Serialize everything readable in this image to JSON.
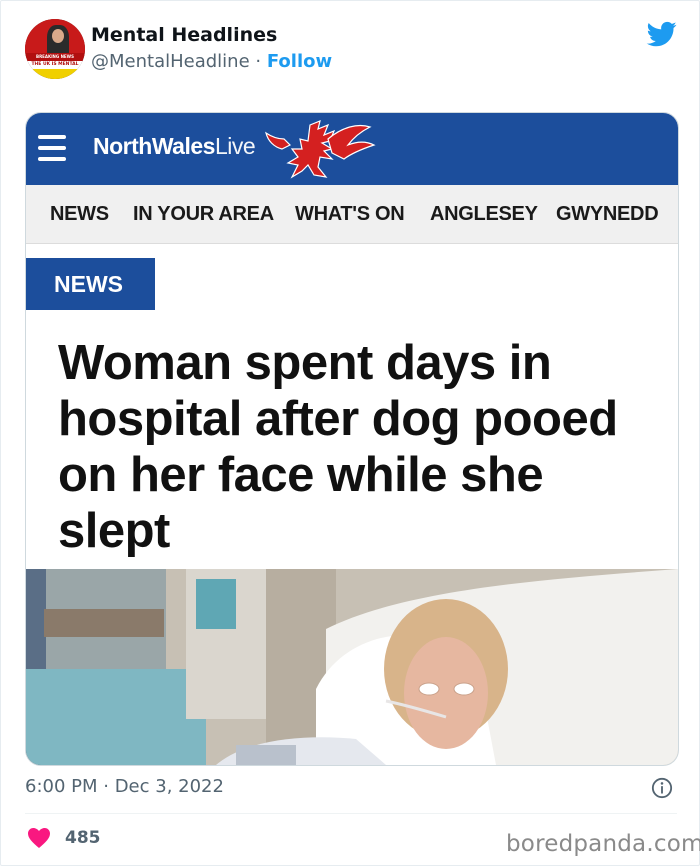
{
  "author": {
    "name": "Mental Headlines",
    "handle": "@MentalHeadline",
    "separator": "·",
    "follow_label": "Follow",
    "avatar_text": {
      "breaking": "BREAKING NEWS",
      "tagline": "THE UK IS MENTAL"
    }
  },
  "article": {
    "site_name_bold": "NorthWales",
    "site_name_light": "Live",
    "nav_items": [
      "NEWS",
      "IN YOUR AREA",
      "WHAT'S ON",
      "ANGLESEY",
      "GWYNEDD"
    ],
    "section_badge": "NEWS",
    "headline": "Woman spent days in hospital after dog pooed on her face while she slept"
  },
  "tweet": {
    "timestamp": "6:00 PM · Dec 3, 2022",
    "like_count": "485"
  },
  "watermark": "boredpanda.com",
  "colors": {
    "twitter_blue": "#1d9bf0",
    "brand_blue": "#1c4e9c",
    "heart": "#f91880",
    "dragon_red": "#d42020"
  },
  "icons": [
    "twitter-bird-icon",
    "hamburger-menu-icon",
    "welsh-dragon-icon",
    "info-icon",
    "heart-icon"
  ]
}
